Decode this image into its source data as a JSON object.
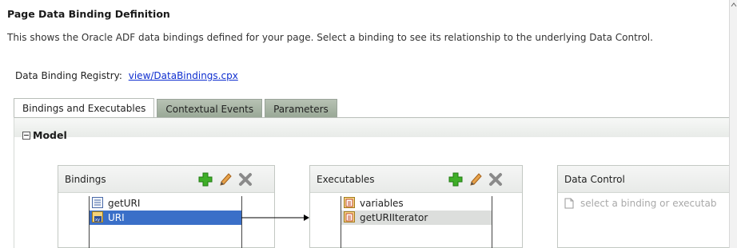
{
  "page": {
    "title": "Page Data Binding Definition",
    "description": "This shows the Oracle ADF data bindings defined for your page. Select a binding to see its relationship to the underlying Data Control.",
    "registry_label": "Data Binding Registry:",
    "registry_link": "view/DataBindings.cpx"
  },
  "tabs": [
    {
      "label": "Bindings and Executables",
      "active": true
    },
    {
      "label": "Contextual Events",
      "active": false
    },
    {
      "label": "Parameters",
      "active": false
    }
  ],
  "model": {
    "label": "Model"
  },
  "bindings": {
    "title": "Bindings",
    "items": [
      {
        "label": "getURI",
        "icon": "method-binding-icon",
        "selected": false
      },
      {
        "label": "URI",
        "icon": "attribute-binding-icon",
        "selected": true
      }
    ]
  },
  "executables": {
    "title": "Executables",
    "items": [
      {
        "label": "variables",
        "icon": "executable-icon"
      },
      {
        "label": "getURIIterator",
        "icon": "iterator-icon",
        "highlighted": true
      }
    ]
  },
  "data_control": {
    "title": "Data Control",
    "placeholder": "select a binding or executab"
  },
  "toolbar_icons": [
    "add-icon",
    "edit-icon",
    "delete-icon"
  ],
  "colors": {
    "link": "#0f2fd0",
    "selection": "#3a6fc8",
    "add_green": "#3fae28"
  }
}
